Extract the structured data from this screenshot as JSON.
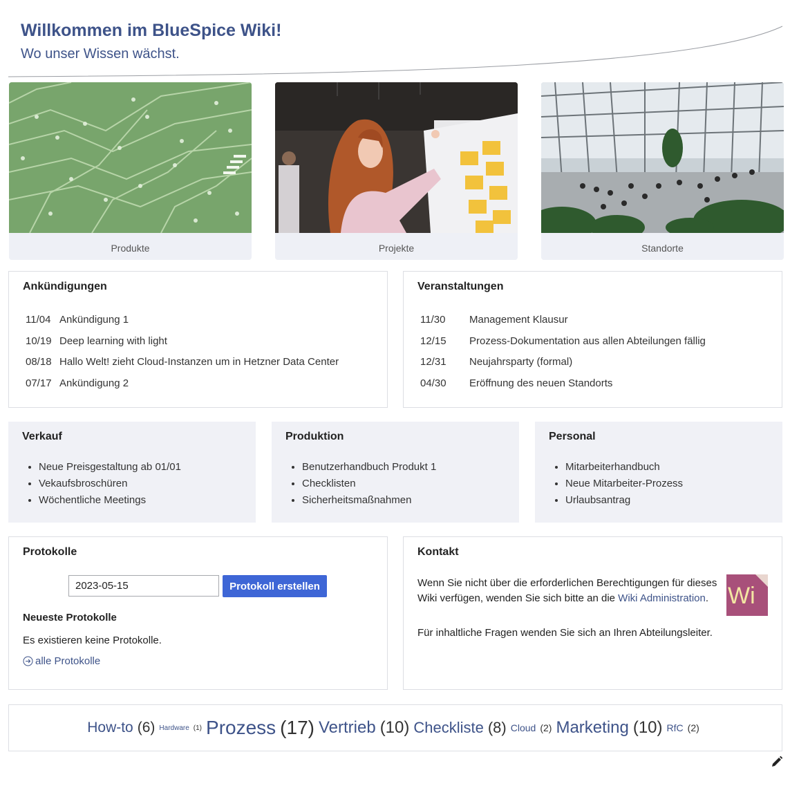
{
  "header": {
    "title": "Willkommen im BlueSpice Wiki!",
    "subtitle": "Wo unser Wissen wächst."
  },
  "tiles": [
    {
      "caption": "Produkte"
    },
    {
      "caption": "Projekte"
    },
    {
      "caption": "Standorte"
    }
  ],
  "announcements": {
    "title": "Ankündigungen",
    "items": [
      {
        "date": "11/04",
        "text": "Ankündigung 1"
      },
      {
        "date": "10/19",
        "text": "Deep learning with light"
      },
      {
        "date": "08/18",
        "text": "Hallo Welt! zieht Cloud-Instanzen um in Hetzner Data Center"
      },
      {
        "date": "07/17",
        "text": "Ankündigung 2"
      }
    ]
  },
  "events": {
    "title": "Veranstaltungen",
    "items": [
      {
        "date": "11/30",
        "text": "Management Klausur"
      },
      {
        "date": "12/15",
        "text": "Prozess-Dokumentation aus allen Abteilungen fällig"
      },
      {
        "date": "12/31",
        "text": "Neujahrsparty (formal)"
      },
      {
        "date": "04/30",
        "text": "Eröffnung des neuen Standorts"
      }
    ]
  },
  "departments": [
    {
      "title": "Verkauf",
      "items": [
        "Neue Preisgestaltung ab 01/01",
        "Vekaufsbroschüren",
        "Wöchentliche Meetings"
      ]
    },
    {
      "title": "Produktion",
      "items": [
        "Benutzerhandbuch Produkt 1",
        "Checklisten",
        "Sicherheitsmaßnahmen"
      ]
    },
    {
      "title": "Personal",
      "items": [
        "Mitarbeiterhandbuch",
        "Neue Mitarbeiter-Prozess",
        "Urlaubsantrag"
      ]
    }
  ],
  "protocols": {
    "title": "Protokolle",
    "date_value": "2023-05-15",
    "button_label": "Protokoll erstellen",
    "latest_heading": "Neueste Protokolle",
    "empty_text": "Es existieren keine Protokolle.",
    "all_link": "alle Protokolle"
  },
  "contact": {
    "title": "Kontakt",
    "text_before_link": "Wenn Sie nicht über die erforderlichen Berechtigungen für dieses Wiki verfügen, wenden Sie sich bitte an die ",
    "link_text": "Wiki Administration",
    "text_after_link": ".",
    "text2": "Für inhaltliche Fragen wenden Sie sich an Ihren Abteilungsleiter.",
    "logo_text": "Wi"
  },
  "tag_cloud": [
    {
      "tag": "How-to",
      "count": "(6)"
    },
    {
      "tag": "Hardware",
      "count": "(1)"
    },
    {
      "tag": "Prozess",
      "count": "(17)"
    },
    {
      "tag": "Vertrieb",
      "count": "(10)"
    },
    {
      "tag": "Checkliste",
      "count": "(8)"
    },
    {
      "tag": "Cloud",
      "count": "(2)"
    },
    {
      "tag": "Marketing",
      "count": "(10)"
    },
    {
      "tag": "RfC",
      "count": "(2)"
    }
  ],
  "colors": {
    "accent": "#3e5389",
    "button": "#3e66d6",
    "panel": "#f0f1f6",
    "border": "#dcdee3"
  }
}
